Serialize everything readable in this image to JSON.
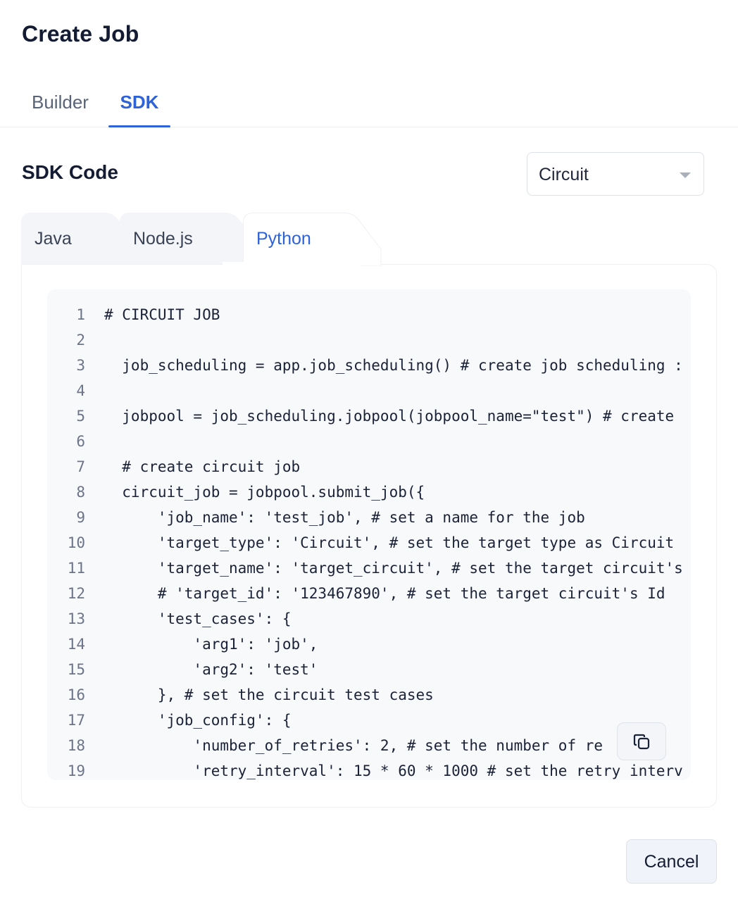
{
  "dialog": {
    "title": "Create Job"
  },
  "top_tabs": [
    {
      "label": "Builder",
      "active": false
    },
    {
      "label": "SDK",
      "active": true
    }
  ],
  "sdk": {
    "section_title": "SDK Code",
    "target_select": {
      "value": "Circuit"
    },
    "language_tabs": [
      {
        "label": "Java",
        "active": false
      },
      {
        "label": "Node.js",
        "active": false
      },
      {
        "label": "Python",
        "active": true
      }
    ],
    "code_lines": [
      {
        "n": "1",
        "text": "# CIRCUIT JOB"
      },
      {
        "n": "2",
        "text": ""
      },
      {
        "n": "3",
        "text": "  job_scheduling = app.job_scheduling() # create job scheduling :"
      },
      {
        "n": "4",
        "text": ""
      },
      {
        "n": "5",
        "text": "  jobpool = job_scheduling.jobpool(jobpool_name=\"test\") # create"
      },
      {
        "n": "6",
        "text": ""
      },
      {
        "n": "7",
        "text": "  # create circuit job"
      },
      {
        "n": "8",
        "text": "  circuit_job = jobpool.submit_job({"
      },
      {
        "n": "9",
        "text": "      'job_name': 'test_job', # set a name for the job"
      },
      {
        "n": "10",
        "text": "      'target_type': 'Circuit', # set the target type as Circuit"
      },
      {
        "n": "11",
        "text": "      'target_name': 'target_circuit', # set the target circuit's"
      },
      {
        "n": "12",
        "text": "      # 'target_id': '123467890', # set the target circuit's Id"
      },
      {
        "n": "13",
        "text": "      'test_cases': {"
      },
      {
        "n": "14",
        "text": "          'arg1': 'job',"
      },
      {
        "n": "15",
        "text": "          'arg2': 'test'"
      },
      {
        "n": "16",
        "text": "      }, # set the circuit test cases"
      },
      {
        "n": "17",
        "text": "      'job_config': {"
      },
      {
        "n": "18",
        "text": "          'number_of_retries': 2, # set the number of re"
      },
      {
        "n": "19",
        "text": "          'retry_interval': 15 * 60 * 1000 # set the retry interv"
      }
    ],
    "copy_icon": "copy-icon"
  },
  "footer": {
    "cancel_label": "Cancel"
  },
  "colors": {
    "accent": "#2e62d9",
    "code_bg": "#f8f9fb",
    "tab_inactive_bg": "#f4f5f8"
  }
}
